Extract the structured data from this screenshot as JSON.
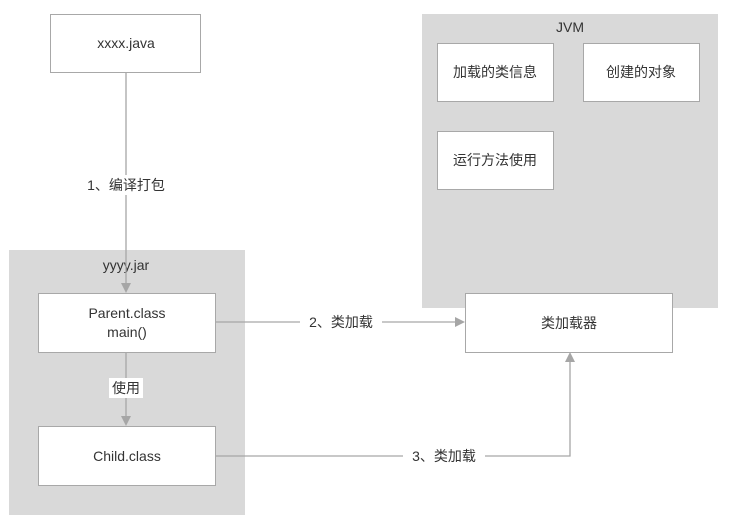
{
  "nodes": {
    "source": "xxxx.java",
    "jar_group": "yyyy.jar",
    "parent_line1": "Parent.class",
    "parent_line2": "main()",
    "child": "Child.class",
    "jvm_group": "JVM",
    "loaded_class_info": "加载的类信息",
    "created_objects": "创建的对象",
    "run_methods": "运行方法使用",
    "class_loader": "类加载器"
  },
  "edges": {
    "compile": "1、编译打包",
    "use": "使用",
    "load_parent": "2、类加载",
    "load_child": "3、类加载"
  },
  "colors": {
    "group_fill": "#d9d9d9",
    "edge": "#a6a6a6",
    "box_stroke": "#a8a8a8"
  }
}
